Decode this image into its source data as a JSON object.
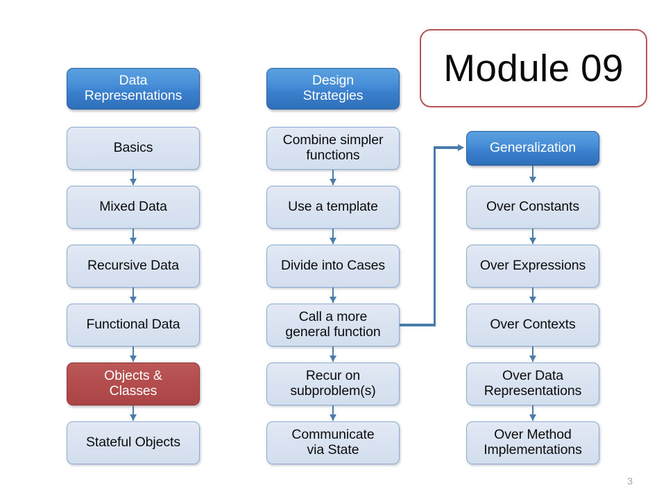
{
  "slide": {
    "title_box": {
      "label": "Module 09"
    },
    "page_number": "3",
    "colors": {
      "header_blue": "#3b80cd",
      "body_light": "#dae3f1",
      "highlight_red": "#b44e4e",
      "title_outline": "#b75252",
      "connector": "#4a7cab",
      "background": "#ffffff"
    }
  },
  "columns": [
    {
      "id": "data-representations",
      "header": {
        "label": "Data\nRepresentations",
        "style": "blue"
      },
      "items": [
        {
          "label": "Basics",
          "style": "light"
        },
        {
          "label": "Mixed Data",
          "style": "light"
        },
        {
          "label": "Recursive Data",
          "style": "light"
        },
        {
          "label": "Functional Data",
          "style": "light"
        },
        {
          "label": "Objects &\nClasses",
          "style": "red"
        },
        {
          "label": "Stateful Objects",
          "style": "light"
        }
      ]
    },
    {
      "id": "design-strategies",
      "header": {
        "label": "Design\nStrategies",
        "style": "blue"
      },
      "items": [
        {
          "label": "Combine simpler\nfunctions",
          "style": "light"
        },
        {
          "label": "Use a template",
          "style": "light"
        },
        {
          "label": "Divide into Cases",
          "style": "light"
        },
        {
          "label": "Call a more\ngeneral function",
          "style": "light"
        },
        {
          "label": "Recur on\nsubproblem(s)",
          "style": "light"
        },
        {
          "label": "Communicate\nvia State",
          "style": "light"
        }
      ]
    },
    {
      "id": "generalization",
      "header": {
        "label": "Generalization",
        "style": "blue"
      },
      "items": [
        {
          "label": "Over Constants",
          "style": "light"
        },
        {
          "label": "Over Expressions",
          "style": "light"
        },
        {
          "label": "Over Contexts",
          "style": "light"
        },
        {
          "label": "Over Data\nRepresentations",
          "style": "light"
        },
        {
          "label": "Over Method\nImplementations",
          "style": "light"
        }
      ]
    }
  ],
  "cross_link": {
    "from": "Call a more general function",
    "to": "Generalization",
    "kind": "elbow-arrow"
  }
}
